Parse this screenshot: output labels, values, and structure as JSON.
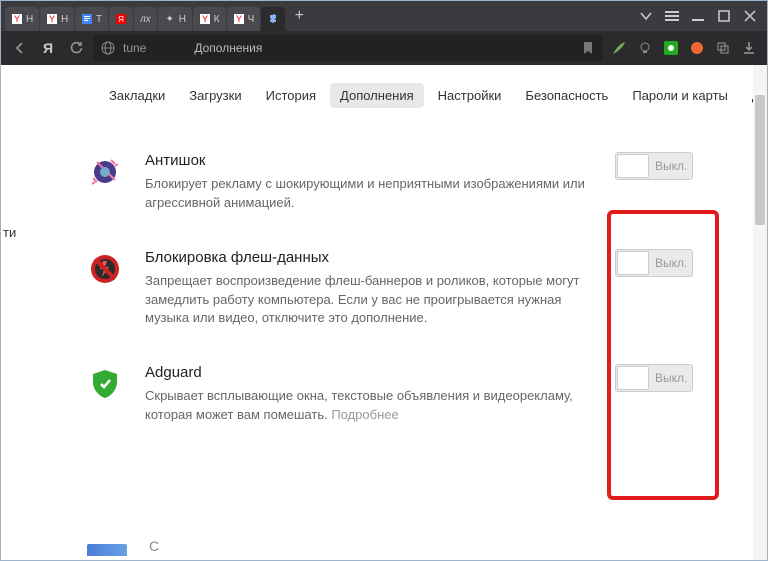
{
  "titlebar": {
    "tabs": [
      {
        "label": "Н",
        "favicon": "Y"
      },
      {
        "label": "Н",
        "favicon": "Y"
      },
      {
        "label": "Т",
        "favicon": "doc"
      },
      {
        "label": "",
        "favicon": "Yb"
      },
      {
        "label": "лх",
        "favicon": "lh"
      },
      {
        "label": "Н",
        "favicon": "star"
      },
      {
        "label": "К",
        "favicon": "Y"
      },
      {
        "label": "Ч",
        "favicon": "Y"
      },
      {
        "label": "",
        "favicon": "puzzle",
        "active": true
      }
    ]
  },
  "addressbar": {
    "url_path": "tune",
    "page_title": "Дополнения"
  },
  "nav": {
    "tabs": [
      "Закладки",
      "Загрузки",
      "История",
      "Дополнения",
      "Настройки",
      "Безопасность",
      "Пароли и карты",
      "Дру"
    ],
    "active_index": 3,
    "left_cut": "ти"
  },
  "addons": [
    {
      "id": "antishock",
      "title": "Антишок",
      "desc": "Блокирует рекламу с шокирующими и неприятными изображениями или агрессивной анимацией.",
      "more": "",
      "toggle": "Выкл."
    },
    {
      "id": "flashblock",
      "title": "Блокировка флеш-данных",
      "desc": "Запрещает воспроизведение флеш-баннеров и роликов, которые могут замедлить работу компьютера. Если у вас не проигрывается нужная музыка или видео, отключите это дополнение.",
      "more": "",
      "toggle": "Выкл."
    },
    {
      "id": "adguard",
      "title": "Adguard",
      "desc": "Скрывает всплывающие окна, текстовые объявления и видеорекламу, которая может вам помешать. ",
      "more": "Подробнее",
      "toggle": "Выкл."
    }
  ],
  "bottom_cut": "С"
}
